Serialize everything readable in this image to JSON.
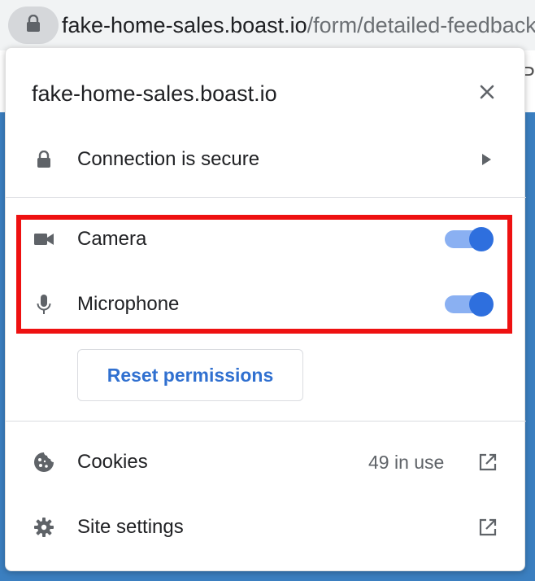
{
  "address_bar": {
    "icon": "lock-icon",
    "host": "fake-home-sales.boast.io",
    "path": "/form/detailed-feedback"
  },
  "background_page": {
    "partial_char": "P"
  },
  "site_info_popup": {
    "title": "fake-home-sales.boast.io",
    "close_icon": "close-icon",
    "connection": {
      "icon": "lock-icon",
      "label": "Connection is secure"
    },
    "permissions": [
      {
        "icon": "camera-icon",
        "label": "Camera",
        "enabled": true
      },
      {
        "icon": "microphone-icon",
        "label": "Microphone",
        "enabled": true
      }
    ],
    "reset_button": "Reset permissions",
    "cookies": {
      "icon": "cookie-icon",
      "label": "Cookies",
      "count": "49 in use"
    },
    "site_settings": {
      "icon": "gear-icon",
      "label": "Site settings"
    }
  },
  "colors": {
    "toggle_on_knob": "#2e6fde",
    "toggle_on_track": "#8ab0f2",
    "highlight_border": "#ee1111",
    "link_blue": "#3070d0"
  }
}
